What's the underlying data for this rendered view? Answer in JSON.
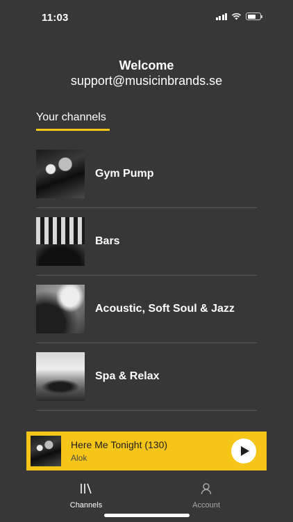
{
  "status_bar": {
    "time": "11:03"
  },
  "header": {
    "welcome": "Welcome",
    "email": "support@musicinbrands.se"
  },
  "section": {
    "title": "Your channels"
  },
  "channels": [
    {
      "name": "Gym Pump"
    },
    {
      "name": "Bars"
    },
    {
      "name": "Acoustic, Soft Soul & Jazz"
    },
    {
      "name": "Spa & Relax"
    }
  ],
  "player": {
    "title": "Here Me Tonight (130)",
    "artist": "Alok"
  },
  "tabs": [
    {
      "label": "Channels",
      "icon": "library-icon"
    },
    {
      "label": "Account",
      "icon": "person-icon"
    }
  ],
  "colors": {
    "background": "#373737",
    "accent": "#f5c518",
    "divider": "#5a5a5a"
  }
}
